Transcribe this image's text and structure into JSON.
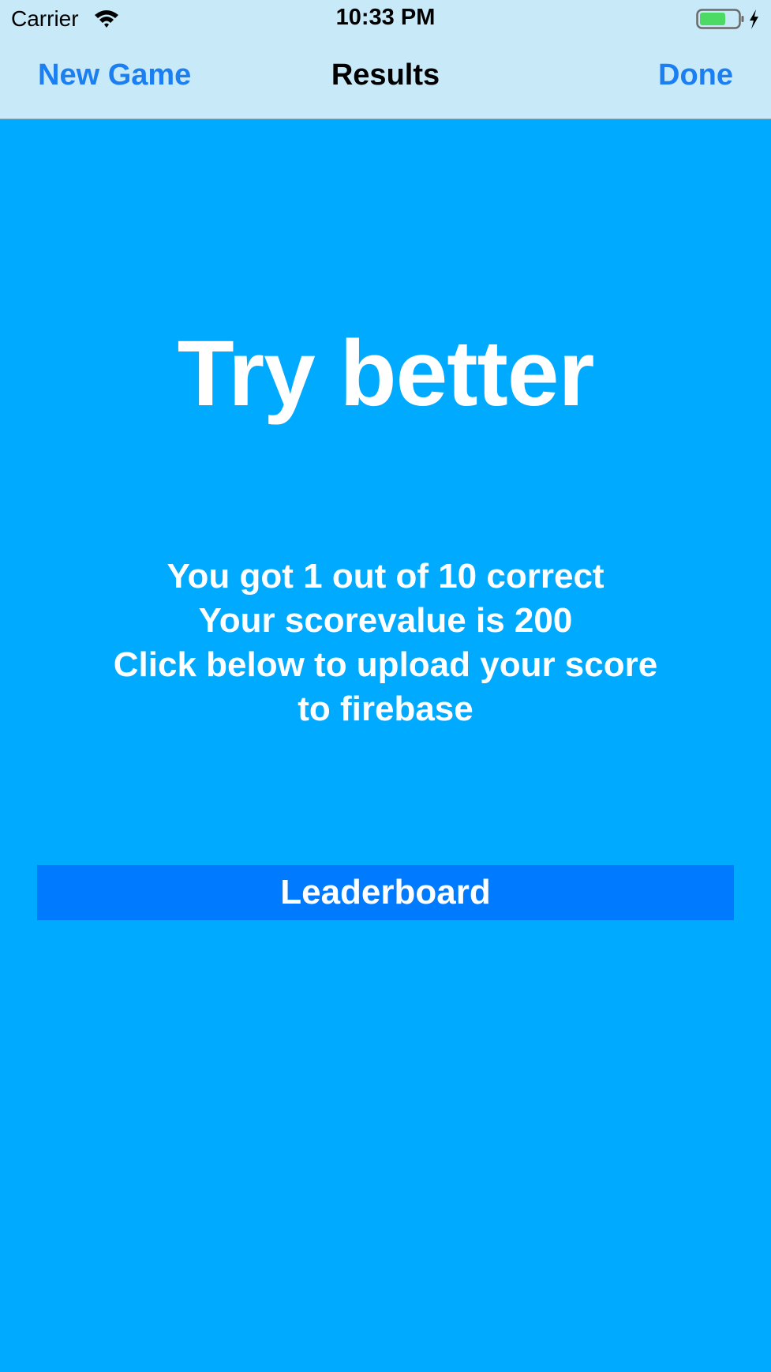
{
  "status_bar": {
    "carrier": "Carrier",
    "time": "10:33 PM",
    "icons": [
      "wifi-icon",
      "battery-icon",
      "charging-bolt-icon"
    ]
  },
  "nav_bar": {
    "left_button": "New Game",
    "title": "Results",
    "right_button": "Done"
  },
  "main": {
    "headline": "Try better",
    "message_lines": [
      "You got 1 out of 10 correct",
      "Your scorevalue is 200",
      "Click below to upload your score",
      "to firebase"
    ],
    "leaderboard_button": "Leaderboard"
  },
  "colors": {
    "background": "#00aaff",
    "bar_background": "#c8e9f8",
    "nav_accent": "#1b7ff2",
    "button_background": "#007aff",
    "battery_fill": "#4cd964"
  }
}
